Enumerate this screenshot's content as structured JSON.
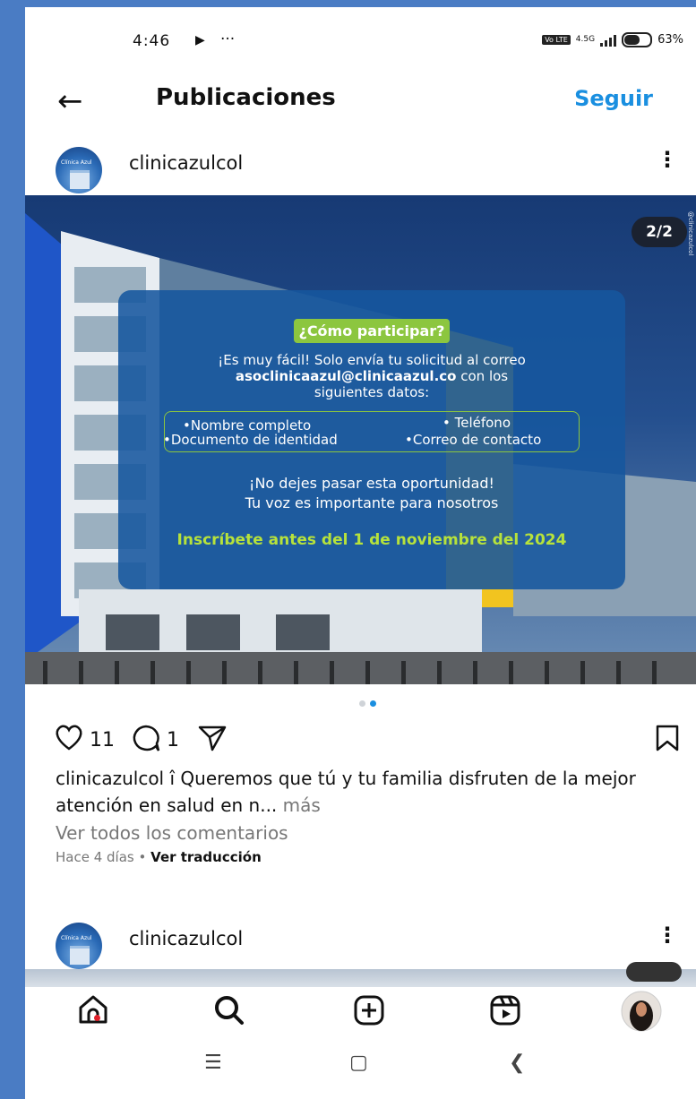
{
  "status_bar": {
    "time": "4:46",
    "battery": "63%",
    "network": "4.5G",
    "volte": "Vo LTE"
  },
  "header": {
    "back_icon": "arrow-left-icon",
    "title": "Publicaciones",
    "follow_label": "Seguir"
  },
  "post": {
    "username": "clinicazulcol",
    "avatar_text": "Clínica Azul",
    "image_counter": "2/2",
    "watermark": "@clinicazulcol",
    "card": {
      "heading": "¿Cómo participar?",
      "intro_1": "¡Es muy fácil! Solo envía tu solicitud al correo",
      "email": "asoclinicaazul@clinicaazul.co",
      "intro_2": " con los",
      "intro_3": "siguientes datos:",
      "items": [
        "•Nombre completo",
        "• Teléfono",
        "•Documento de identidad",
        "•Correo de contacto"
      ],
      "cta_1": "¡No dejes pasar esta oportunidad!",
      "cta_2": "Tu voz es importante para nosotros",
      "deadline": "Inscríbete antes del 1 de noviembre del 2024"
    },
    "carousel": {
      "count": 2,
      "active": 2
    },
    "likes": "11",
    "comments": "1",
    "caption_user": "clinicazulcol",
    "caption_text": " î Queremos que tú y tu familia disfruten de la mejor atención en salud en n...",
    "caption_more": " más",
    "view_comments": "Ver todos los comentarios",
    "time_ago": "Hace 4 días",
    "separator": "•",
    "translate": "Ver traducción"
  },
  "next_post": {
    "username": "clinicazulcol"
  },
  "colors": {
    "accent": "#1a8fe0",
    "card": "#16569e",
    "highlight": "#8cc63f",
    "deadline": "#b7e23b"
  }
}
